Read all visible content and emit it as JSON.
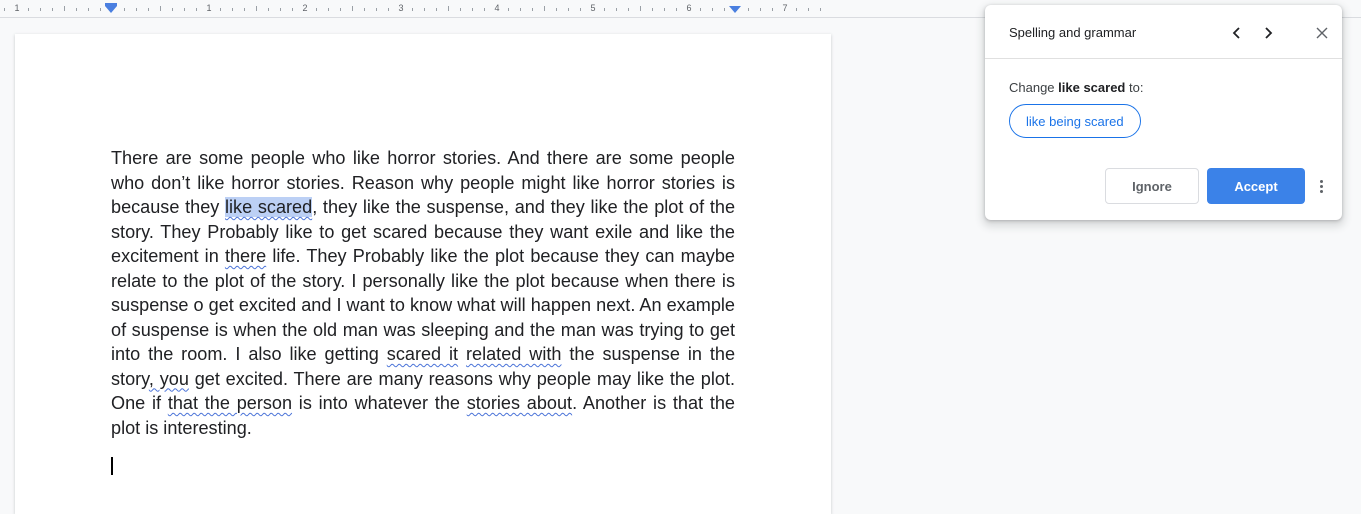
{
  "ruler": {
    "numbers": [
      "1",
      "1",
      "2",
      "3",
      "4",
      "5",
      "6",
      "7"
    ]
  },
  "document": {
    "paragraph": {
      "s1": "There are some people who like horror stories. And there are some people who don’t like horror stories. Reason why people might like horror stories is because they ",
      "w1": "like scared",
      "s2": ", they like the suspense, and they like the plot of the story. They Probably like to get scared because they want exile and like the excitement in ",
      "w2": "there",
      "s3": " life. They Probably like the plot because they can maybe relate to the plot of the story. I personally like the plot because when there is suspense o get excited and I want to know what will happen next. An example of suspense is when the old man was sleeping and the man was trying to get into the room. I also like getting ",
      "w3": "scared it",
      "s4": " ",
      "w4": "related with",
      "s5": " the suspense in the story",
      "w5": ", you",
      "s6": " get excited. There are many reasons why people may like the plot. One if ",
      "w6": "that the person",
      "s7": " is into whatever the ",
      "w7": "stories about",
      "s8": ". Another is that the plot is interesting."
    }
  },
  "panel": {
    "title": "Spelling and grammar",
    "change_prefix": "Change ",
    "change_term": "like scared",
    "change_suffix": " to:",
    "suggestion": "like being scared",
    "ignore_label": "Ignore",
    "accept_label": "Accept",
    "accent_color": "#1a73e8"
  }
}
